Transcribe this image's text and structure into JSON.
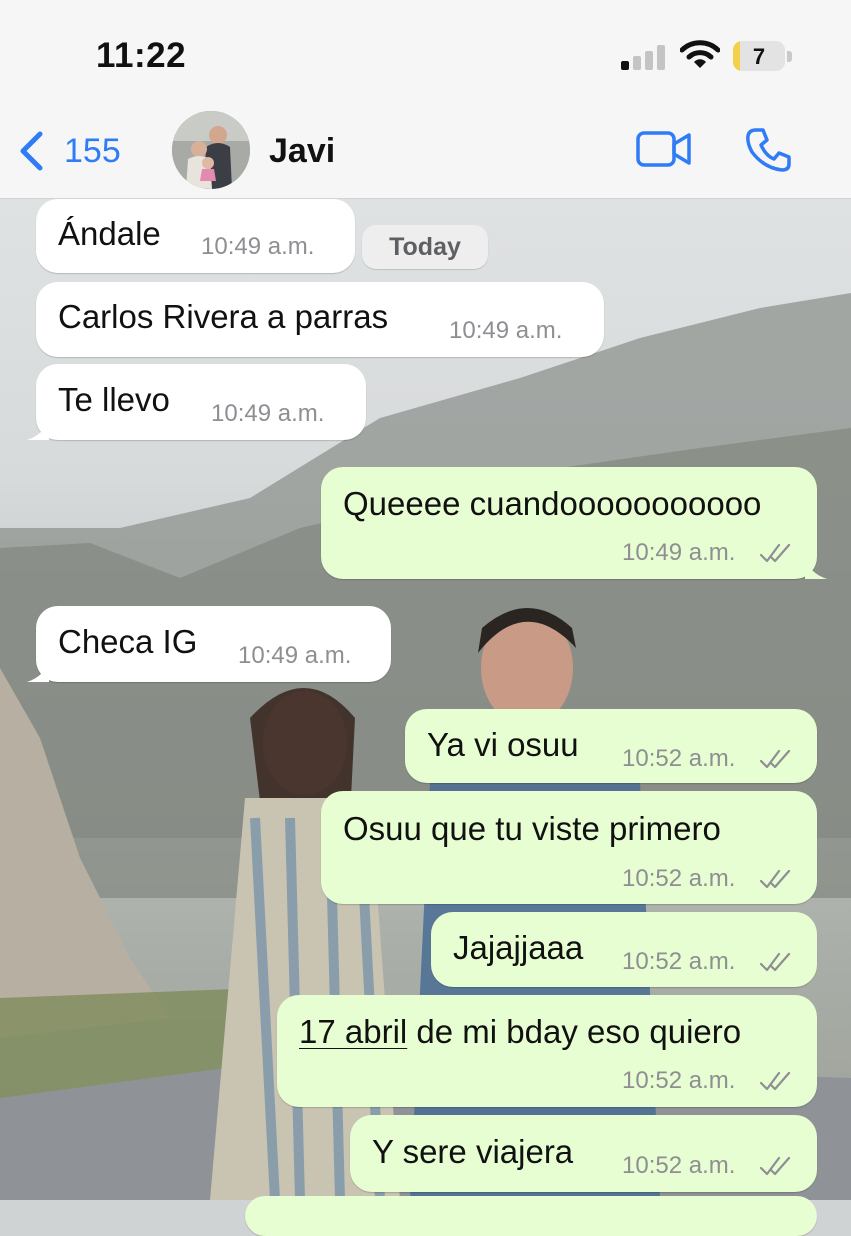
{
  "status_bar": {
    "time": "11:22",
    "battery": "7"
  },
  "header": {
    "back_count": "155",
    "contact_name": "Javi"
  },
  "date_chip": "Today",
  "messages": [
    {
      "direction": "in",
      "text": "Ándale",
      "time": "10:49 a.m."
    },
    {
      "direction": "in",
      "text": "Carlos Rivera a parras",
      "time": "10:49 a.m."
    },
    {
      "direction": "in",
      "text": "Te llevo",
      "time": "10:49 a.m."
    },
    {
      "direction": "out",
      "text": "Queeee cuandooooooooooo",
      "time": "10:49 a.m.",
      "status": "read"
    },
    {
      "direction": "in",
      "text": "Checa IG",
      "time": "10:49 a.m."
    },
    {
      "direction": "out",
      "text": "Ya vi osuu",
      "time": "10:52 a.m.",
      "status": "read"
    },
    {
      "direction": "out",
      "text": "Osuu que tu viste primero",
      "time": "10:52 a.m.",
      "status": "read"
    },
    {
      "direction": "out",
      "text": "Jajajjaaa",
      "time": "10:52 a.m.",
      "status": "read"
    },
    {
      "direction": "out",
      "text_link": "17 abril",
      "text": " de mi bday eso quiero",
      "time": "10:52 a.m.",
      "status": "read"
    },
    {
      "direction": "out",
      "text": "Y sere viajera",
      "time": "10:52 a.m.",
      "status": "read"
    }
  ],
  "colors": {
    "accent": "#2f7cf6",
    "incoming_bubble": "#ffffff",
    "outgoing_bubble": "#e7fdd2",
    "timestamp": "#8e8e93"
  },
  "icons": [
    "signal-icon",
    "wifi-icon",
    "battery-icon",
    "chevron-left-icon",
    "video-call-icon",
    "phone-icon",
    "double-check-icon"
  ]
}
